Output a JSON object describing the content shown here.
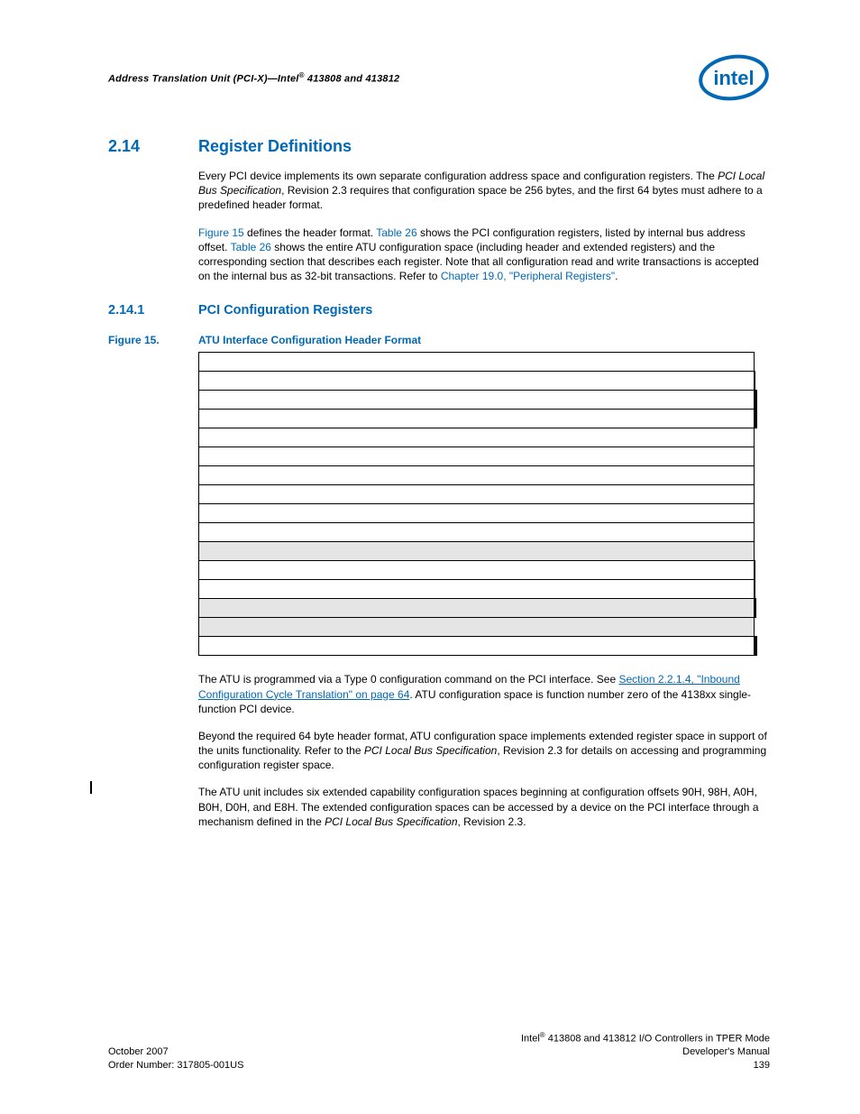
{
  "header": {
    "text_before_sup": "Address Translation Unit (PCI-X)—Intel",
    "sup": "®",
    "text_after_sup": " 413808 and 413812"
  },
  "logo_name": "intel-logo",
  "section": {
    "num": "2.14",
    "title": "Register Definitions",
    "para1_a": "Every PCI device implements its own separate configuration address space and configuration registers. The ",
    "para1_em": "PCI Local Bus Specification",
    "para1_b": ", Revision 2.3 requires that configuration space be 256 bytes, and the first 64 bytes must adhere to a predefined header format.",
    "para2_l1": "Figure 15",
    "para2_a": " defines the header format. ",
    "para2_l2": "Table 26",
    "para2_b": " shows the PCI configuration registers, listed by internal bus address offset. ",
    "para2_l3": "Table 26",
    "para2_c": " shows the entire ATU configuration space (including header and extended registers) and the corresponding section that describes each register. Note that all configuration read and write transactions is accepted on the internal bus as 32-bit transactions. Refer to ",
    "para2_l4": "Chapter 19.0, \"Peripheral Registers\"",
    "para2_d": "."
  },
  "subsection": {
    "num": "2.14.1",
    "title": "PCI Configuration Registers"
  },
  "figure": {
    "label": "Figure 15.",
    "title": "ATU Interface Configuration Header Format",
    "rows": [
      {
        "cols": 1,
        "shaded": false
      },
      {
        "cols": 2,
        "shaded": false
      },
      {
        "cols": 4,
        "shaded": false
      },
      {
        "cols": 4,
        "shaded": false
      },
      {
        "cols": 1,
        "shaded": false
      },
      {
        "cols": 1,
        "shaded": false
      },
      {
        "cols": 1,
        "shaded": false
      },
      {
        "cols": 1,
        "shaded": false
      },
      {
        "cols": 1,
        "shaded": false
      },
      {
        "cols": 1,
        "shaded": false
      },
      {
        "cols": 1,
        "shaded": true
      },
      {
        "cols": 2,
        "shaded": false
      },
      {
        "cols": 2,
        "shaded": false
      },
      {
        "cols": 3,
        "shaded": true
      },
      {
        "cols": 1,
        "shaded": true
      },
      {
        "cols": 4,
        "shaded": false
      }
    ]
  },
  "body": {
    "p3_a": "The ATU is programmed via a Type 0 configuration command on the PCI interface. See ",
    "p3_link": "Section 2.2.1.4, \"Inbound Configuration Cycle Translation\" on page 64",
    "p3_b": ". ATU configuration space is function number zero of the 4138xx single-function PCI device.",
    "p4_a": "Beyond the required 64 byte header format, ATU configuration space implements extended register space in support of the units functionality. Refer to the ",
    "p4_em": "PCI Local Bus Specification",
    "p4_b": ", Revision 2.3 for details on accessing and programming configuration register space.",
    "p5_a": "The ATU unit includes six extended capability configuration spaces beginning at configuration offsets 90H, 98H, A0H, B0H, D0H, and E8H. The extended configuration spaces can be accessed by a device on the PCI interface through a mechanism defined in the ",
    "p5_em": "PCI Local Bus Specification",
    "p5_b": ", Revision 2.3."
  },
  "footer": {
    "left1": "October 2007",
    "left2": "Order Number: 317805-001US",
    "right1_a": "Intel",
    "right1_sup": "®",
    "right1_b": " 413808 and 413812 I/O Controllers in TPER Mode",
    "right2": "Developer's Manual",
    "right3": "139"
  }
}
